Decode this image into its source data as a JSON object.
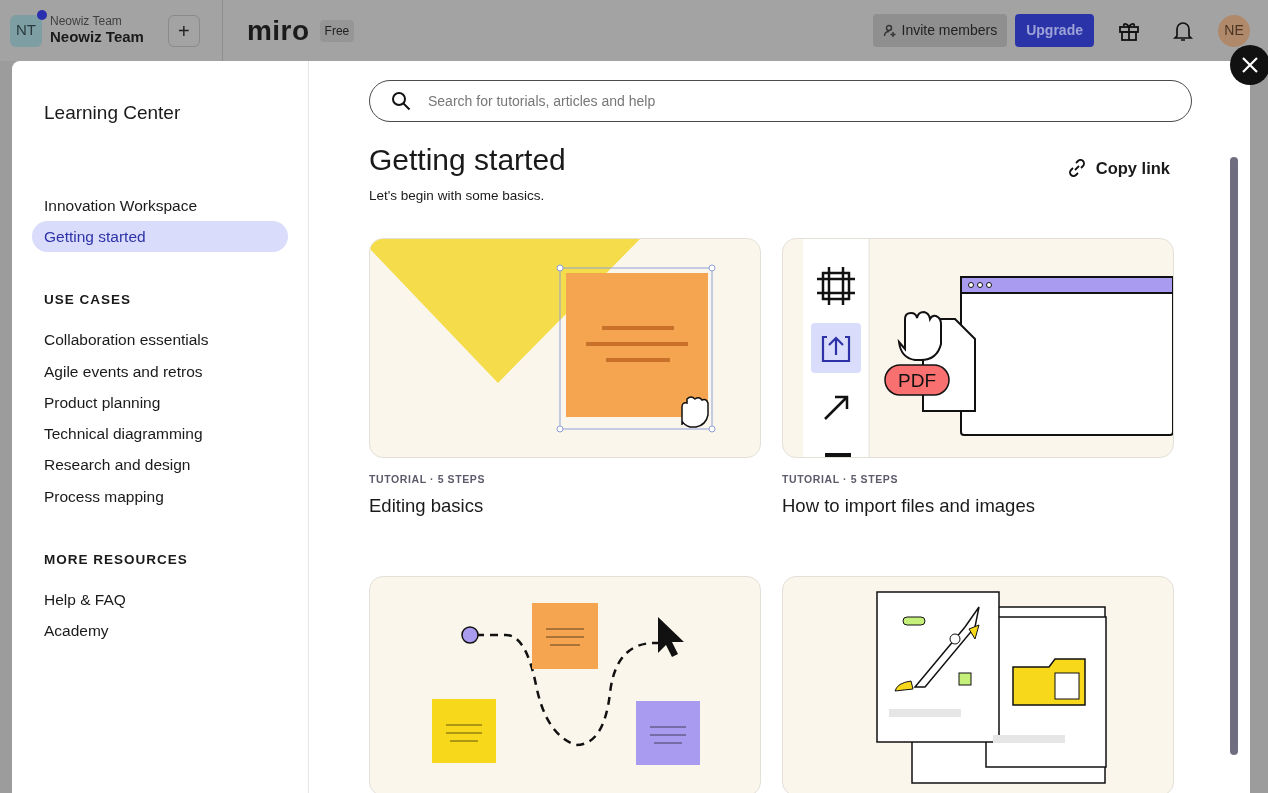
{
  "topbar": {
    "team_avatar": "NT",
    "team_caption": "Neowiz Team",
    "team_name": "Neowiz Team",
    "add_button": "+",
    "logo": "miro",
    "plan_badge": "Free",
    "invite_button": "Invite members",
    "upgrade_button": "Upgrade",
    "user_avatar": "NE"
  },
  "sidebar": {
    "title": "Learning Center",
    "items": [
      {
        "label": "Innovation Workspace",
        "selected": false
      },
      {
        "label": "Getting started",
        "selected": true
      }
    ],
    "sections": [
      {
        "heading": "USE CASES",
        "items": [
          {
            "label": "Collaboration essentials",
            "selected": false
          },
          {
            "label": "Agile events and retros",
            "selected": false
          },
          {
            "label": "Product planning",
            "selected": false
          },
          {
            "label": "Technical diagramming",
            "selected": false
          },
          {
            "label": "Research and design",
            "selected": false
          },
          {
            "label": "Process mapping",
            "selected": false
          }
        ]
      },
      {
        "heading": "MORE RESOURCES",
        "items": [
          {
            "label": "Help & FAQ",
            "selected": false
          },
          {
            "label": "Academy",
            "selected": false
          }
        ]
      }
    ]
  },
  "search": {
    "placeholder": "Search for tutorials, articles and help"
  },
  "heading": "Getting started",
  "copy_link": "Copy link",
  "subtitle": "Let's begin with some basics.",
  "cards": [
    {
      "kind": "editing",
      "meta": "TUTORIAL · 5 STEPS",
      "title": "Editing basics"
    },
    {
      "kind": "import",
      "file_label": "PDF",
      "meta": "TUTORIAL · 5 STEPS",
      "title": "How to import files and images"
    },
    {
      "kind": "flow"
    },
    {
      "kind": "launch"
    }
  ]
}
